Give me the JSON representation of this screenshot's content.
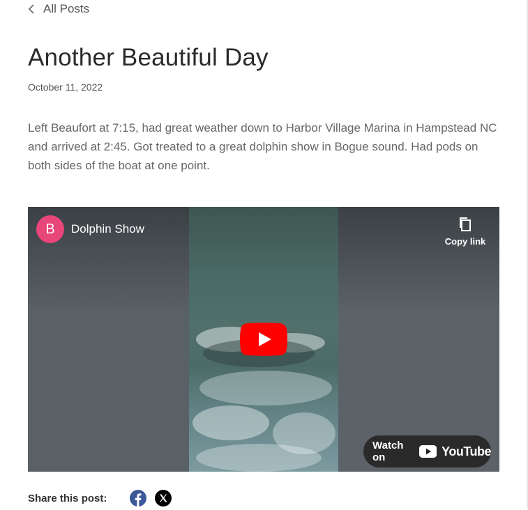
{
  "nav": {
    "back_label": "All Posts"
  },
  "post": {
    "title": "Another Beautiful Day",
    "date": "October 11, 2022",
    "body": "Left Beaufort at 7:15, had great weather down to Harbor Village Marina in Hampstead NC and arrived at 2:45. Got treated to a great dolphin show in Bogue sound. Had pods on both sides of the boat at one point."
  },
  "video": {
    "channel_initial": "B",
    "title": "Dolphin Show",
    "copy_link_label": "Copy link",
    "watch_on_label": "Watch on",
    "youtube_label": "YouTube",
    "colors": {
      "avatar": "#e8457a",
      "play": "#ff0000"
    }
  },
  "share": {
    "label": "Share this post:",
    "icons": [
      "facebook-icon",
      "x-icon"
    ]
  }
}
